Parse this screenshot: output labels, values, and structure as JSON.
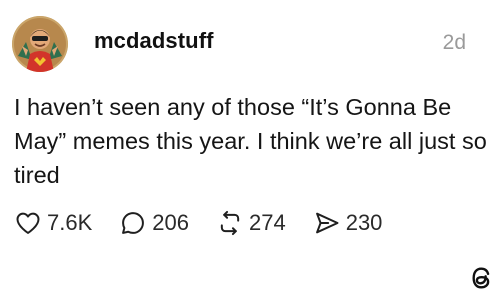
{
  "post": {
    "author": {
      "username": "mcdadstuff",
      "avatar_icon": "superhero-avatar-icon"
    },
    "timestamp": "2d",
    "text": "I haven’t seen any of those “It’s Gonna Be May” memes this year. I think we’re all just so tired",
    "actions": {
      "likes": "7.6K",
      "replies": "206",
      "reposts": "274",
      "shares": "230"
    }
  },
  "brand": {
    "logo_icon": "threads-logo-icon"
  },
  "colors": {
    "text": "#111111",
    "muted": "#9a9a9a",
    "avatar_bg": "#caa56a",
    "avatar_accent": "#d2342a"
  }
}
